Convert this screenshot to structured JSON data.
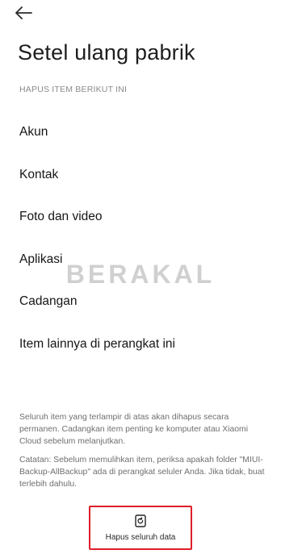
{
  "header": {
    "back_icon": "arrow-left-icon",
    "title": "Setel ulang pabrik"
  },
  "section": {
    "header": "HAPUS ITEM BERIKUT INI"
  },
  "items": [
    {
      "label": "Akun"
    },
    {
      "label": "Kontak"
    },
    {
      "label": "Foto dan video"
    },
    {
      "label": "Aplikasi"
    },
    {
      "label": "Cadangan"
    },
    {
      "label": "Item lainnya di perangkat ini"
    }
  ],
  "watermark": "BERAKAL",
  "notes": {
    "warning": "Seluruh item yang terlampir di atas akan dihapus secara permanen. Cadangkan item penting ke komputer atau Xiaomi Cloud sebelum melanjutkan.",
    "caution": "Catatan: Sebelum memulihkan item, periksa apakah folder \"MIUI-Backup-AllBackup\" ada di perangkat seluler Anda. Jika tidak, buat terlebih dahulu."
  },
  "action": {
    "icon": "erase-phone-icon",
    "label": "Hapus seluruh data",
    "highlight_color": "#e01e2a"
  }
}
